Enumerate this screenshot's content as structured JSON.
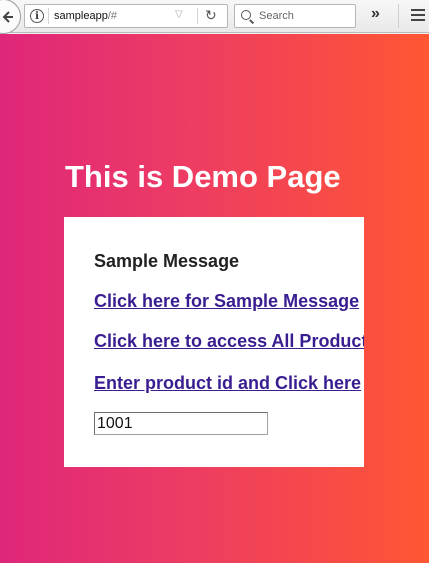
{
  "browser": {
    "url_host": "sampleapp",
    "url_path": "/#",
    "search_placeholder": "Search",
    "info_icon_glyph": "i",
    "back_icon": "back-arrow-icon",
    "reload_icon": "reload-icon",
    "overflow_glyph": "»"
  },
  "page": {
    "heading": "This is Demo Page",
    "gradient": [
      "#e0267a",
      "#ff5633"
    ],
    "card": {
      "message": "Sample Message",
      "links": [
        "Click here for Sample Message",
        "Click here to access All Products",
        "Enter product id and Click here"
      ],
      "product_id_value": "1001"
    }
  }
}
